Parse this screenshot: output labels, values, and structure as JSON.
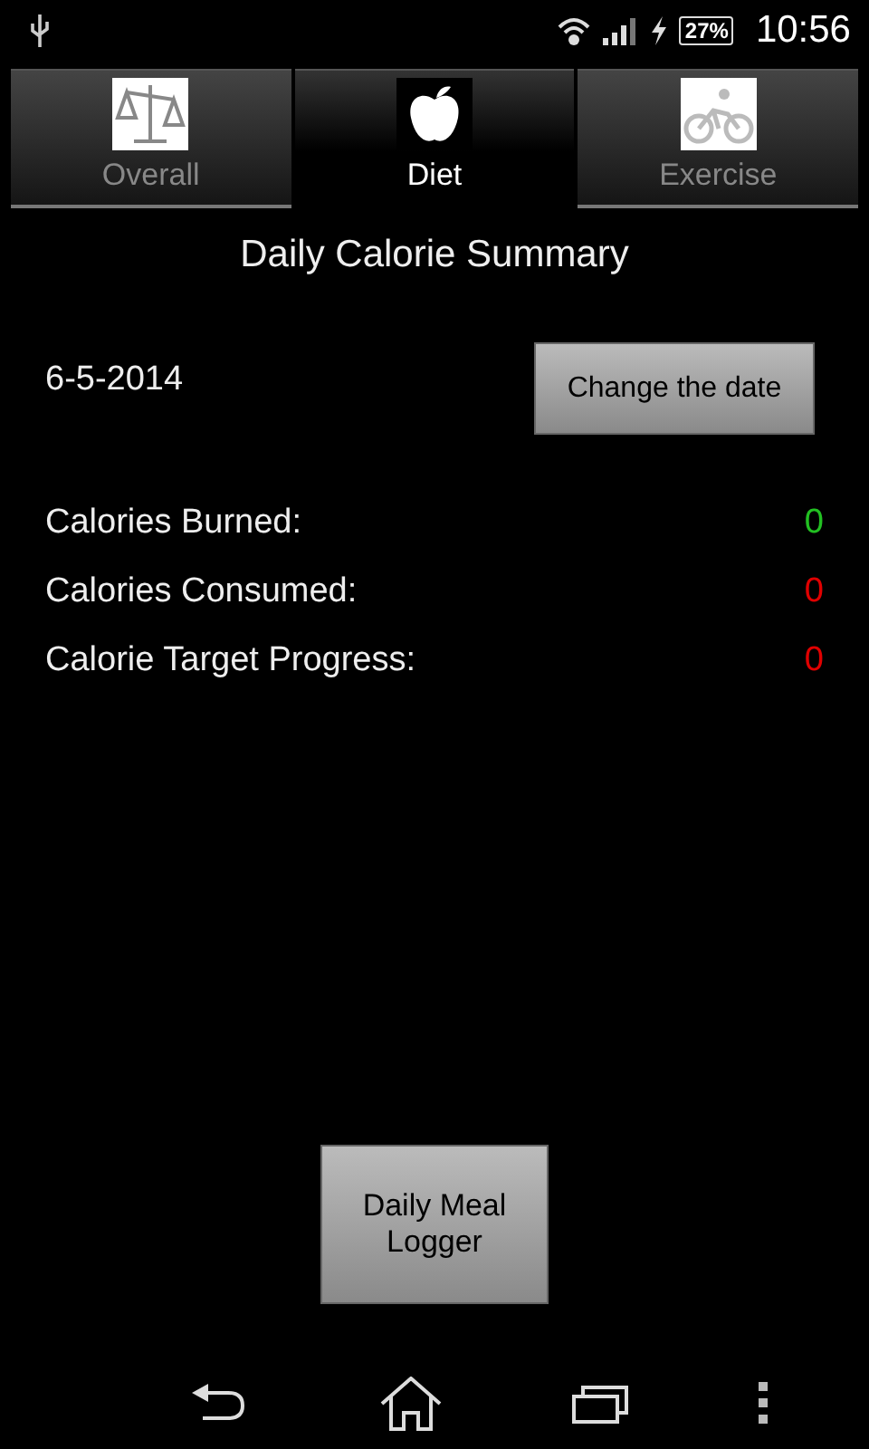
{
  "status_bar": {
    "battery": "27%",
    "time": "10:56"
  },
  "tabs": [
    {
      "label": "Overall",
      "kind": "scale",
      "selected": false
    },
    {
      "label": "Diet",
      "kind": "apple",
      "selected": true
    },
    {
      "label": "Exercise",
      "kind": "bike",
      "selected": false
    }
  ],
  "title": "Daily Calorie Summary",
  "date": "6-5-2014",
  "change_date_button": "Change the date",
  "stats": [
    {
      "label": "Calories Burned:",
      "value": "0",
      "color": "#22c022"
    },
    {
      "label": "Calories Consumed:",
      "value": "0",
      "color": "#e00000"
    },
    {
      "label": "Calorie Target Progress:",
      "value": "0",
      "color": "#e00000"
    }
  ],
  "logger_button": "Daily Meal Logger"
}
